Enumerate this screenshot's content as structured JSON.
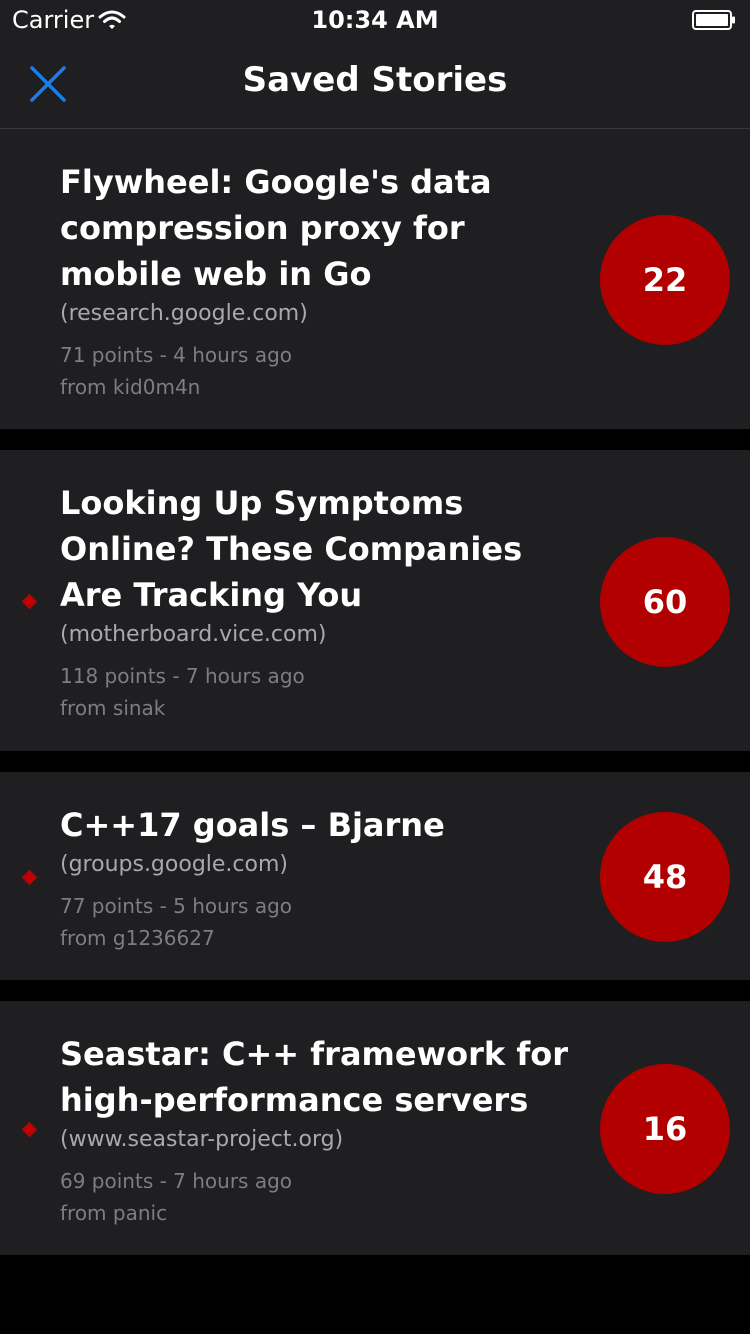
{
  "status_bar": {
    "carrier": "Carrier",
    "time": "10:34 AM"
  },
  "nav": {
    "title": "Saved Stories",
    "close_icon": "close-icon"
  },
  "colors": {
    "accent": "#1a7ee8",
    "badge": "#b20000",
    "unread_dot": "#c00000",
    "cell_bg": "#1f1f21"
  },
  "stories": [
    {
      "title": "Flywheel: Google's data compression proxy for mobile web in Go",
      "domain": "(research.google.com)",
      "points_time": "71 points - 4 hours ago",
      "author": "from kid0m4n",
      "comments": "22",
      "unread": false
    },
    {
      "title": "Looking Up Symptoms Online? These Companies Are Tracking You",
      "domain": "(motherboard.vice.com)",
      "points_time": "118 points - 7 hours ago",
      "author": "from sinak",
      "comments": "60",
      "unread": true
    },
    {
      "title": "C++17 goals – Bjarne",
      "domain": "(groups.google.com)",
      "points_time": "77 points - 5 hours ago",
      "author": "from g1236627",
      "comments": "48",
      "unread": true
    },
    {
      "title": "Seastar: C++ framework for high-performance servers",
      "domain": "(www.seastar-project.org)",
      "points_time": "69 points - 7 hours ago",
      "author": "from panic",
      "comments": "16",
      "unread": true
    }
  ]
}
